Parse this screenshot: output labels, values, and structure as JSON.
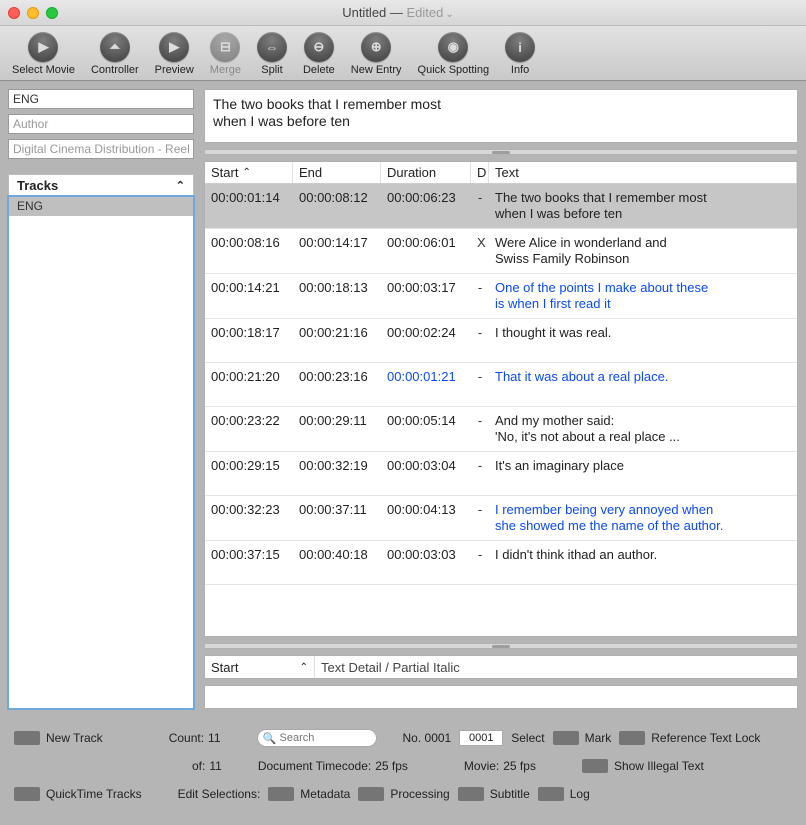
{
  "title": {
    "name": "Untitled",
    "sep": " — ",
    "state": "Edited"
  },
  "toolbar": [
    {
      "id": "select-movie",
      "label": "Select Movie",
      "glyph": "▶"
    },
    {
      "id": "controller",
      "label": "Controller",
      "glyph": "⏶"
    },
    {
      "id": "preview",
      "label": "Preview",
      "glyph": "▶"
    },
    {
      "id": "merge",
      "label": "Merge",
      "glyph": "⊟",
      "disabled": true
    },
    {
      "id": "split",
      "label": "Split",
      "glyph": "⇔"
    },
    {
      "id": "delete",
      "label": "Delete",
      "glyph": "⊖"
    },
    {
      "id": "new-entry",
      "label": "New Entry",
      "glyph": "⊕"
    },
    {
      "id": "quick-spotting",
      "label": "Quick Spotting",
      "glyph": "◉"
    },
    {
      "id": "info",
      "label": "Info",
      "glyph": "i"
    }
  ],
  "left": {
    "lang": "ENG",
    "author_ph": "Author",
    "reel_ph": "Digital Cinema Distribution - Reel ID",
    "tracks_label": "Tracks",
    "tracks": [
      {
        "name": "ENG",
        "selected": true
      }
    ]
  },
  "editor_text": "The two books that I remember most\nwhen I was before ten",
  "grid": {
    "cols": {
      "start": "Start",
      "end": "End",
      "dur": "Duration",
      "d": "D",
      "text": "Text"
    },
    "rows": [
      {
        "start": "00:00:01:14",
        "end": "00:00:08:12",
        "dur": "00:00:06:23",
        "d": "-",
        "text": "The two books that I remember most\nwhen I was before ten",
        "sel": true
      },
      {
        "start": "00:00:08:16",
        "end": "00:00:14:17",
        "dur": "00:00:06:01",
        "d": "X",
        "text": "Were Alice in wonderland and\nSwiss Family Robinson"
      },
      {
        "start": "00:00:14:21",
        "end": "00:00:18:13",
        "dur": "00:00:03:17",
        "d": "-",
        "text": "One of the points I make about these\nis when I first read it",
        "blue": true
      },
      {
        "start": "00:00:18:17",
        "end": "00:00:21:16",
        "dur": "00:00:02:24",
        "d": "-",
        "text": "I thought it was real."
      },
      {
        "start": "00:00:21:20",
        "end": "00:00:23:16",
        "dur": "00:00:01:21",
        "d": "-",
        "text": "That it was about a real place.",
        "blue": true,
        "dur_warn": true
      },
      {
        "start": "00:00:23:22",
        "end": "00:00:29:11",
        "dur": "00:00:05:14",
        "d": "-",
        "text": "And my mother said:\n'No, it's not about a real place ..."
      },
      {
        "start": "00:00:29:15",
        "end": "00:00:32:19",
        "dur": "00:00:03:04",
        "d": "-",
        "text": "It's an imaginary place"
      },
      {
        "start": "00:00:32:23",
        "end": "00:00:37:11",
        "dur": "00:00:04:13",
        "d": "-",
        "text": "I remember being very annoyed when\nshe showed me the name of the author.",
        "blue": true
      },
      {
        "start": "00:00:37:15",
        "end": "00:00:40:18",
        "dur": "00:00:03:03",
        "d": "-",
        "text": "I didn't think ithad an author."
      }
    ]
  },
  "detail": {
    "start": "Start",
    "detail": "Text Detail / Partial Italic"
  },
  "bottom": {
    "new_track": "New Track",
    "quicktime": "QuickTime Tracks",
    "count_lbl": "Count:",
    "count": "11",
    "of_lbl": "of:",
    "of": "11",
    "search_ph": "Search",
    "no_lbl": "No. 0001",
    "no_val": "0001",
    "select": "Select",
    "mark": "Mark",
    "reftext": "Reference Text Lock",
    "doc_tc_lbl": "Document Timecode:",
    "doc_tc": "25 fps",
    "movie_lbl": "Movie:",
    "movie": "25 fps",
    "illegal": "Show Illegal Text",
    "editsel": "Edit Selections:",
    "meta": "Metadata",
    "proc": "Processing",
    "subtitle": "Subtitle",
    "log": "Log"
  }
}
